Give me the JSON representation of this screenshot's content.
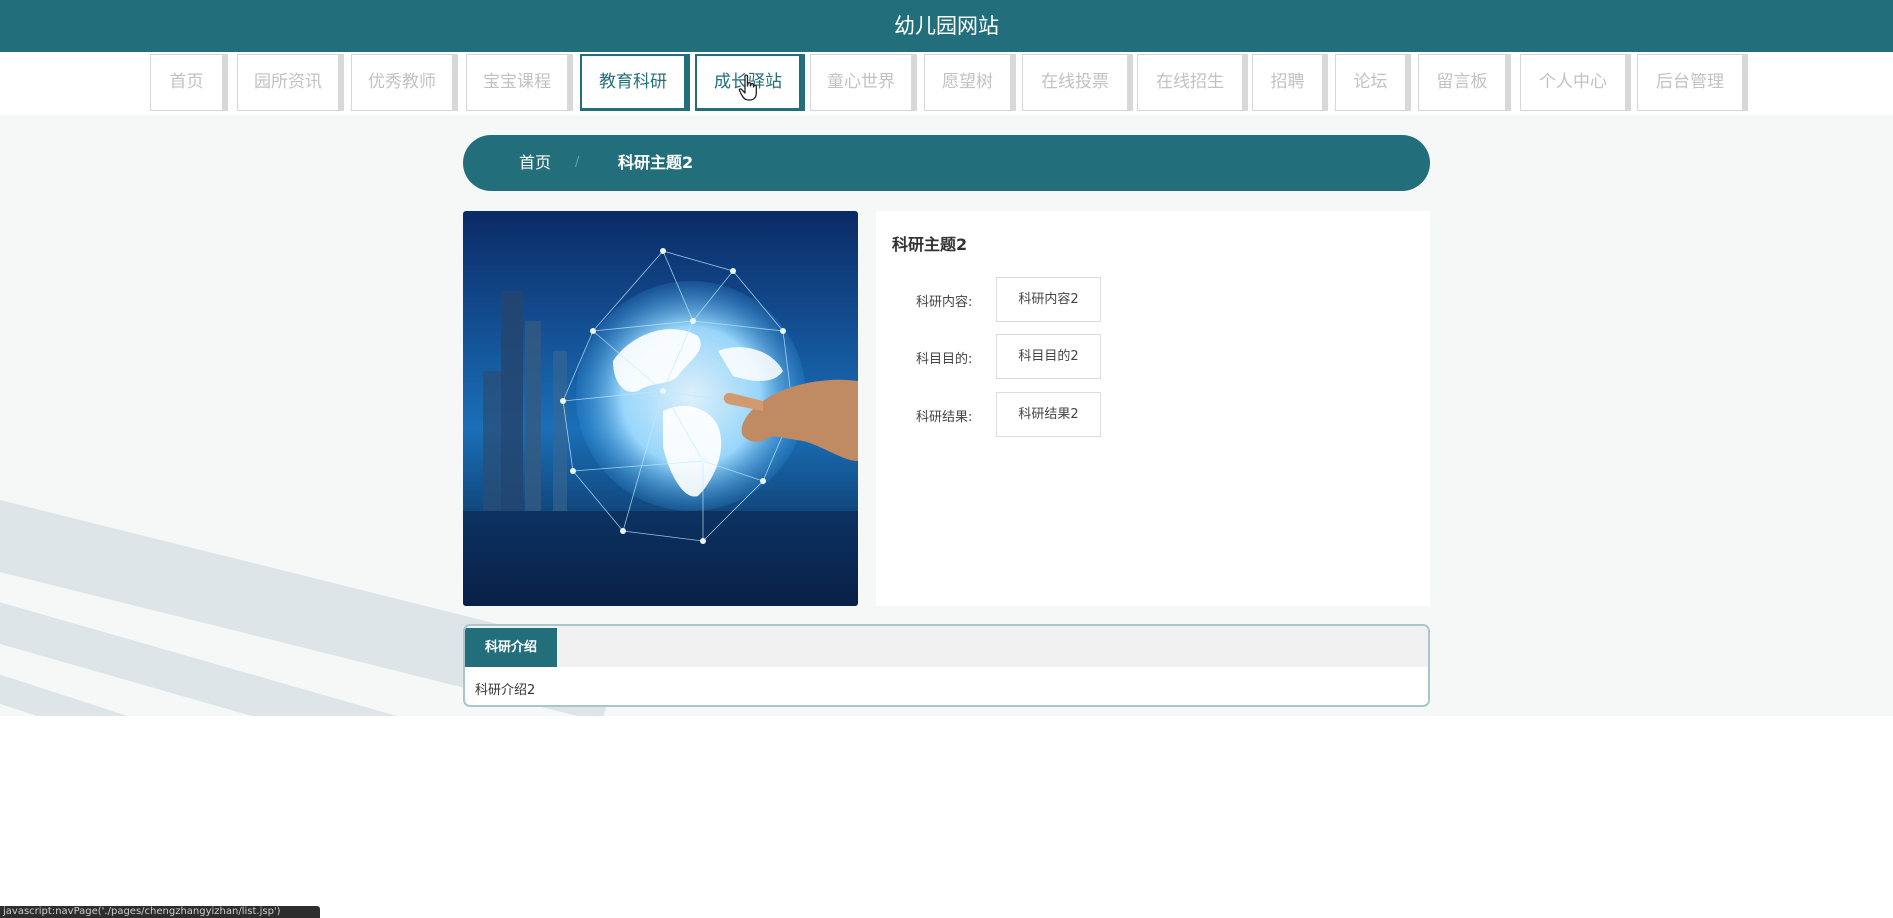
{
  "header": {
    "title": "幼儿园网站"
  },
  "nav": {
    "items": [
      {
        "label": "首页",
        "active": false
      },
      {
        "label": "园所资讯",
        "active": false
      },
      {
        "label": "优秀教师",
        "active": false
      },
      {
        "label": "宝宝课程",
        "active": false
      },
      {
        "label": "教育科研",
        "active": true
      },
      {
        "label": "成长驿站",
        "active": true
      },
      {
        "label": "童心世界",
        "active": false
      },
      {
        "label": "愿望树",
        "active": false
      },
      {
        "label": "在线投票",
        "active": false
      },
      {
        "label": "在线招生",
        "active": false
      },
      {
        "label": "招聘",
        "active": false
      },
      {
        "label": "论坛",
        "active": false
      },
      {
        "label": "留言板",
        "active": false
      },
      {
        "label": "个人中心",
        "active": false
      },
      {
        "label": "后台管理",
        "active": false
      }
    ]
  },
  "breadcrumb": {
    "home": "首页",
    "separator": "/",
    "current": "科研主题2"
  },
  "detail": {
    "title": "科研主题2",
    "fields": [
      {
        "label": "科研内容:",
        "value": "科研内容2"
      },
      {
        "label": "科目目的:",
        "value": "科目目的2"
      },
      {
        "label": "科研结果:",
        "value": "科研结果2"
      }
    ]
  },
  "intro": {
    "tab_label": "科研介绍",
    "body": "科研介绍2"
  },
  "statusbar": {
    "text": "javascript:navPage('./pages/chengzhangyizhan/list.jsp')"
  },
  "colors": {
    "primary": "#226e7b",
    "inactive_text": "#c2c2c2",
    "background": "#f6f8f8"
  },
  "icons": {
    "cursor": "hand-pointer-icon",
    "photo": "globe-network-image"
  }
}
